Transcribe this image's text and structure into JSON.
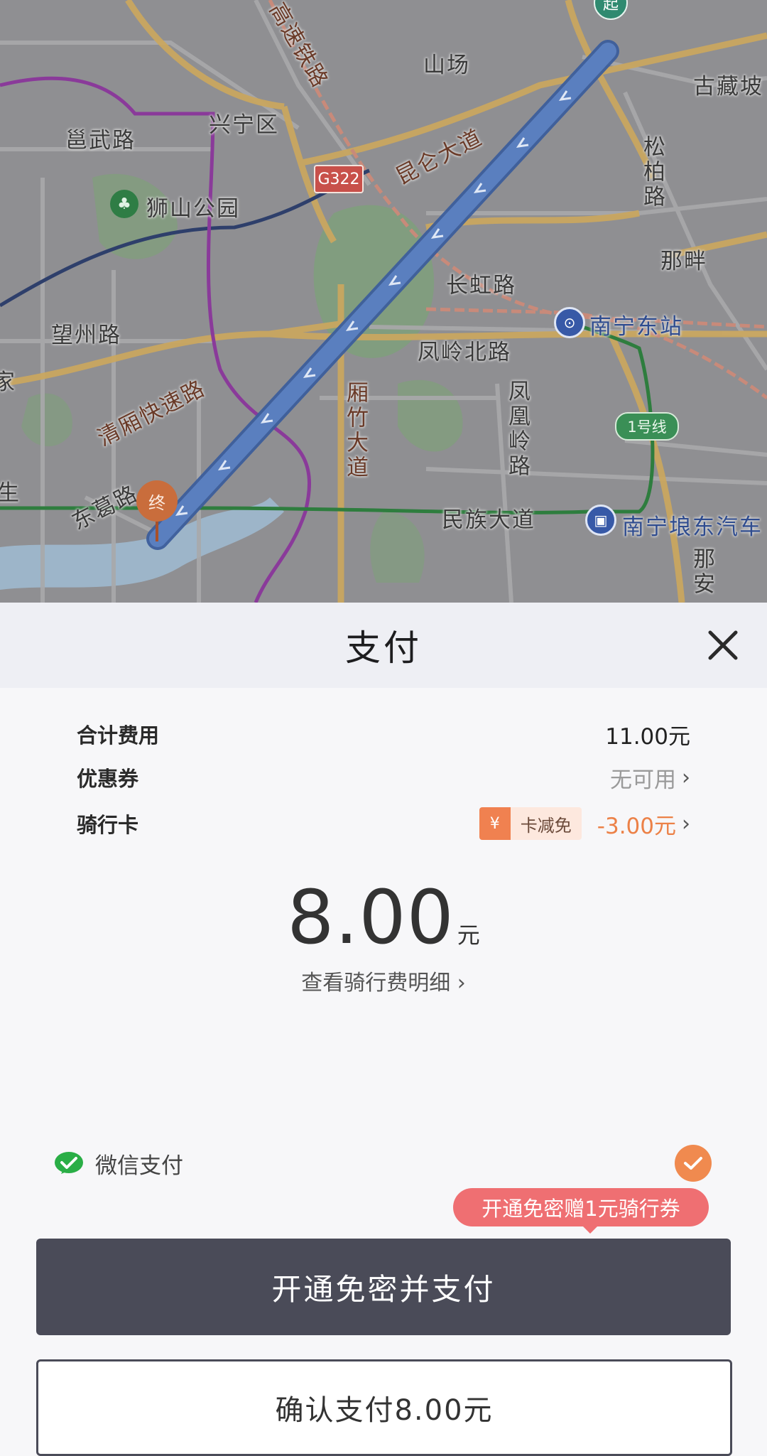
{
  "map": {
    "labels": {
      "shanchang": "山场",
      "guzangpo": "古藏坡",
      "xingning": "兴宁区",
      "yongwu": "邕武路",
      "shishan": "狮山公园",
      "kunlun": "昆仑大道",
      "songbai": "松柏路",
      "napan": "那畔",
      "changhong": "长虹路",
      "nanning_east": "南宁东站",
      "wangzhou": "望州路",
      "fengling_north": "凤岭北路",
      "qingxiang": "清厢快速路",
      "xiangzhu": "厢竹大道",
      "fenghuangling": "凤凰岭路",
      "donge": "东葛路",
      "minzu": "民族大道",
      "langdong": "南宁埌东汽车",
      "naan": "那安",
      "railway": "高速铁路",
      "edge_sheng": "生",
      "edge_jia": "家"
    },
    "g322": "G322",
    "line1": "1号线",
    "start_pin": "起",
    "end_pin": "终"
  },
  "sheet": {
    "title": "支付",
    "rows": {
      "total_label": "合计费用",
      "total_value": "11.00元",
      "coupon_label": "优惠券",
      "coupon_value": "无可用",
      "card_label": "骑行卡",
      "card_yuan": "¥",
      "card_tag": "卡减免",
      "card_amount": "-3.00元"
    },
    "pay_amount": "8.00",
    "pay_unit": "元",
    "detail_link": "查看骑行费明细 ›",
    "payment_method": "微信支付",
    "promo": "开通免密赠1元骑行券",
    "primary_button": "开通免密并支付",
    "secondary_button": "确认支付8.00元"
  },
  "colors": {
    "route": "#4d72b0",
    "accent_orange": "#f08a4f",
    "button_dark": "#4a4b58",
    "promo": "#ef6f72",
    "wechat_green": "#2aae46"
  }
}
